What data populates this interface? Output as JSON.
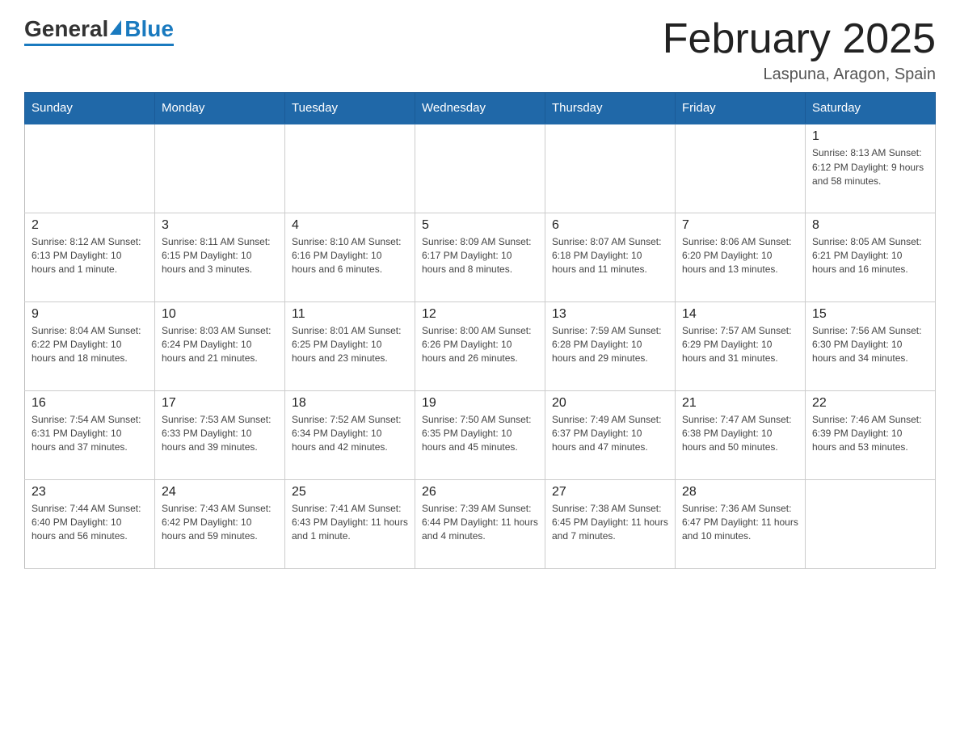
{
  "header": {
    "logo_general": "General",
    "logo_blue": "Blue",
    "month_title": "February 2025",
    "location": "Laspuna, Aragon, Spain"
  },
  "days_of_week": [
    "Sunday",
    "Monday",
    "Tuesday",
    "Wednesday",
    "Thursday",
    "Friday",
    "Saturday"
  ],
  "weeks": [
    [
      {
        "day": "",
        "info": ""
      },
      {
        "day": "",
        "info": ""
      },
      {
        "day": "",
        "info": ""
      },
      {
        "day": "",
        "info": ""
      },
      {
        "day": "",
        "info": ""
      },
      {
        "day": "",
        "info": ""
      },
      {
        "day": "1",
        "info": "Sunrise: 8:13 AM\nSunset: 6:12 PM\nDaylight: 9 hours and 58 minutes."
      }
    ],
    [
      {
        "day": "2",
        "info": "Sunrise: 8:12 AM\nSunset: 6:13 PM\nDaylight: 10 hours and 1 minute."
      },
      {
        "day": "3",
        "info": "Sunrise: 8:11 AM\nSunset: 6:15 PM\nDaylight: 10 hours and 3 minutes."
      },
      {
        "day": "4",
        "info": "Sunrise: 8:10 AM\nSunset: 6:16 PM\nDaylight: 10 hours and 6 minutes."
      },
      {
        "day": "5",
        "info": "Sunrise: 8:09 AM\nSunset: 6:17 PM\nDaylight: 10 hours and 8 minutes."
      },
      {
        "day": "6",
        "info": "Sunrise: 8:07 AM\nSunset: 6:18 PM\nDaylight: 10 hours and 11 minutes."
      },
      {
        "day": "7",
        "info": "Sunrise: 8:06 AM\nSunset: 6:20 PM\nDaylight: 10 hours and 13 minutes."
      },
      {
        "day": "8",
        "info": "Sunrise: 8:05 AM\nSunset: 6:21 PM\nDaylight: 10 hours and 16 minutes."
      }
    ],
    [
      {
        "day": "9",
        "info": "Sunrise: 8:04 AM\nSunset: 6:22 PM\nDaylight: 10 hours and 18 minutes."
      },
      {
        "day": "10",
        "info": "Sunrise: 8:03 AM\nSunset: 6:24 PM\nDaylight: 10 hours and 21 minutes."
      },
      {
        "day": "11",
        "info": "Sunrise: 8:01 AM\nSunset: 6:25 PM\nDaylight: 10 hours and 23 minutes."
      },
      {
        "day": "12",
        "info": "Sunrise: 8:00 AM\nSunset: 6:26 PM\nDaylight: 10 hours and 26 minutes."
      },
      {
        "day": "13",
        "info": "Sunrise: 7:59 AM\nSunset: 6:28 PM\nDaylight: 10 hours and 29 minutes."
      },
      {
        "day": "14",
        "info": "Sunrise: 7:57 AM\nSunset: 6:29 PM\nDaylight: 10 hours and 31 minutes."
      },
      {
        "day": "15",
        "info": "Sunrise: 7:56 AM\nSunset: 6:30 PM\nDaylight: 10 hours and 34 minutes."
      }
    ],
    [
      {
        "day": "16",
        "info": "Sunrise: 7:54 AM\nSunset: 6:31 PM\nDaylight: 10 hours and 37 minutes."
      },
      {
        "day": "17",
        "info": "Sunrise: 7:53 AM\nSunset: 6:33 PM\nDaylight: 10 hours and 39 minutes."
      },
      {
        "day": "18",
        "info": "Sunrise: 7:52 AM\nSunset: 6:34 PM\nDaylight: 10 hours and 42 minutes."
      },
      {
        "day": "19",
        "info": "Sunrise: 7:50 AM\nSunset: 6:35 PM\nDaylight: 10 hours and 45 minutes."
      },
      {
        "day": "20",
        "info": "Sunrise: 7:49 AM\nSunset: 6:37 PM\nDaylight: 10 hours and 47 minutes."
      },
      {
        "day": "21",
        "info": "Sunrise: 7:47 AM\nSunset: 6:38 PM\nDaylight: 10 hours and 50 minutes."
      },
      {
        "day": "22",
        "info": "Sunrise: 7:46 AM\nSunset: 6:39 PM\nDaylight: 10 hours and 53 minutes."
      }
    ],
    [
      {
        "day": "23",
        "info": "Sunrise: 7:44 AM\nSunset: 6:40 PM\nDaylight: 10 hours and 56 minutes."
      },
      {
        "day": "24",
        "info": "Sunrise: 7:43 AM\nSunset: 6:42 PM\nDaylight: 10 hours and 59 minutes."
      },
      {
        "day": "25",
        "info": "Sunrise: 7:41 AM\nSunset: 6:43 PM\nDaylight: 11 hours and 1 minute."
      },
      {
        "day": "26",
        "info": "Sunrise: 7:39 AM\nSunset: 6:44 PM\nDaylight: 11 hours and 4 minutes."
      },
      {
        "day": "27",
        "info": "Sunrise: 7:38 AM\nSunset: 6:45 PM\nDaylight: 11 hours and 7 minutes."
      },
      {
        "day": "28",
        "info": "Sunrise: 7:36 AM\nSunset: 6:47 PM\nDaylight: 11 hours and 10 minutes."
      },
      {
        "day": "",
        "info": ""
      }
    ]
  ]
}
